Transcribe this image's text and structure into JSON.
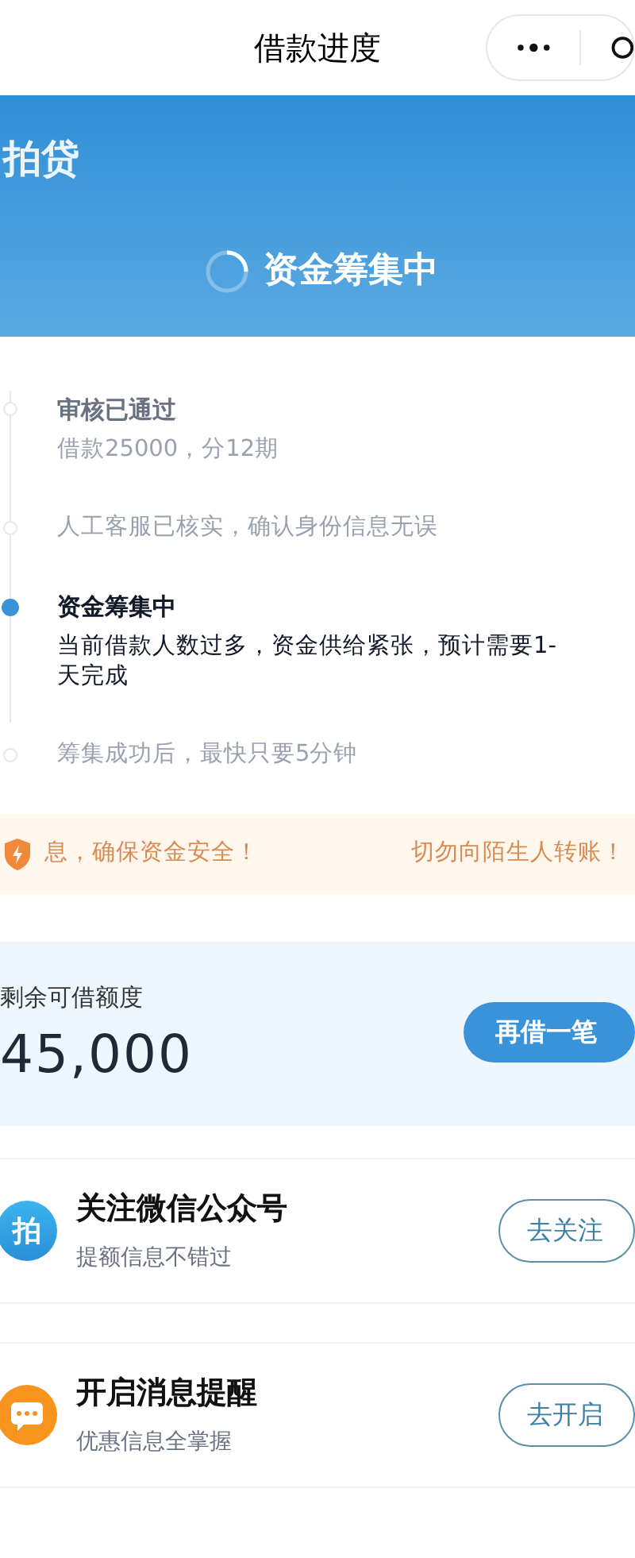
{
  "nav": {
    "title": "借款进度"
  },
  "banner": {
    "logo": "拍贷",
    "status": "资金筹集中"
  },
  "steps": [
    {
      "title": "审核已通过",
      "lines": [
        "借款25000，分12期"
      ],
      "active": false
    },
    {
      "lines": [
        "人工客服已核实，确认身份信息无误"
      ],
      "active": false
    },
    {
      "title": "资金筹集中",
      "lines": [
        "当前借款人数过多，资金供给紧张，预计需要1-",
        "天完成"
      ],
      "active": true
    },
    {
      "lines": [
        "筹集成功后，最快只要5分钟"
      ],
      "active": false
    }
  ],
  "notice": {
    "texts": [
      "息，确保资金安全！",
      "切勿向陌生人转账！"
    ]
  },
  "credit": {
    "label": "剩余可借额度",
    "amount": "45,000",
    "button": "再借一笔"
  },
  "cards": [
    {
      "kind": "follow",
      "icon_text": "拍",
      "title": "关注微信公众号",
      "subtitle": "提额信息不错过",
      "button": "去关注"
    },
    {
      "kind": "notify",
      "title": "开启消息提醒",
      "subtitle": "优惠信息全掌握",
      "button": "去开启"
    }
  ]
}
